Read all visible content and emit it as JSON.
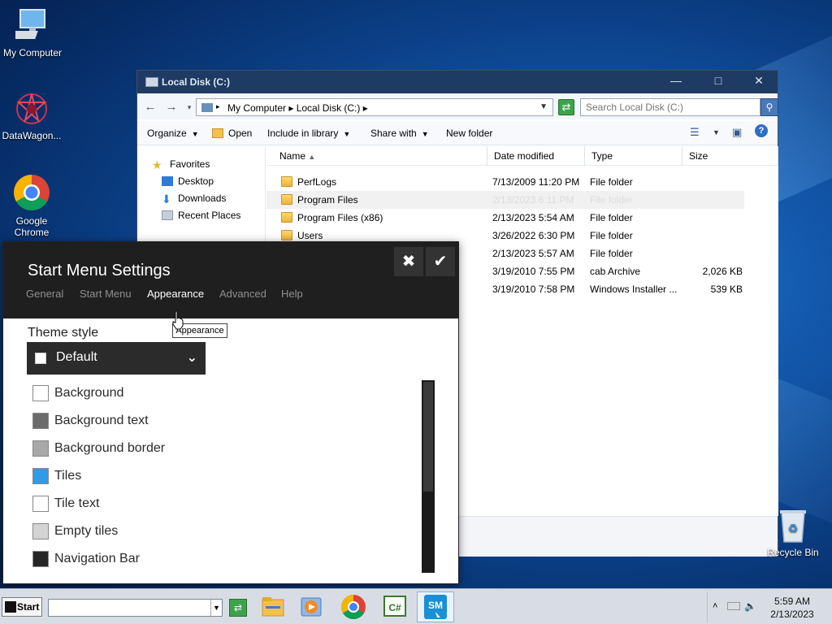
{
  "desktop": {
    "icons": [
      {
        "label": "My Computer"
      },
      {
        "label": "DataWagon..."
      },
      {
        "label": "Google Chrome"
      }
    ],
    "recycle_bin": "Recycle Bin"
  },
  "explorer": {
    "title": "Local Disk (C:)",
    "address": "My Computer  ▸  Local Disk (C:)  ▸",
    "search_placeholder": "Search Local Disk (C:)",
    "toolbar": {
      "organize": "Organize",
      "open": "Open",
      "include_in_library": "Include in library",
      "share_with": "Share with",
      "new_folder": "New folder"
    },
    "nav": {
      "favorites": "Favorites",
      "desktop": "Desktop",
      "downloads": "Downloads",
      "recent_places": "Recent Places"
    },
    "columns": {
      "name": "Name",
      "date": "Date modified",
      "type": "Type",
      "size": "Size"
    },
    "files": [
      {
        "name": "PerfLogs",
        "date": "7/13/2009 11:20 PM",
        "type": "File folder",
        "size": ""
      },
      {
        "name": "Program Files",
        "date": "2/13/2023 6:11 PM",
        "type": "File folder",
        "size": ""
      },
      {
        "name": "Program Files (x86)",
        "date": "2/13/2023 5:54 AM",
        "type": "File folder",
        "size": ""
      },
      {
        "name": "Users",
        "date": "3/26/2022 6:30 PM",
        "type": "File folder",
        "size": ""
      },
      {
        "name": "",
        "date": "2/13/2023 5:57 AM",
        "type": "File folder",
        "size": ""
      },
      {
        "name": "",
        "date": "3/19/2010 7:55 PM",
        "type": "cab Archive",
        "size": "2,026 KB"
      },
      {
        "name": "",
        "date": "3/19/2010 7:58 PM",
        "type": "Windows Installer ...",
        "size": "539 KB"
      }
    ]
  },
  "dialog": {
    "title": "Start Menu Settings",
    "tabs": [
      "General",
      "Start Menu",
      "Appearance",
      "Advanced",
      "Help"
    ],
    "active_tab": "Appearance",
    "tooltip": "Appearance",
    "theme_label": "Theme style",
    "theme_value": "Default",
    "options": [
      {
        "label": "Background",
        "color": "#ffffff"
      },
      {
        "label": "Background text",
        "color": "#6b6b6b"
      },
      {
        "label": "Background border",
        "color": "#a8a8a8"
      },
      {
        "label": "Tiles",
        "color": "#2e9be8"
      },
      {
        "label": "Tile text",
        "color": "#ffffff"
      },
      {
        "label": "Empty tiles",
        "color": "#d4d4d4"
      },
      {
        "label": "Navigation Bar",
        "color": "#262626"
      }
    ]
  },
  "taskbar": {
    "start": "Start",
    "time": "5:59 AM",
    "date": "2/13/2023"
  }
}
